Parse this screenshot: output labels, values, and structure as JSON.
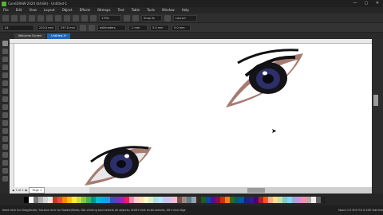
{
  "window": {
    "title": "CorelDRAW 2020 (64-Bit) - Untitled-1",
    "min": "—",
    "max": "▢",
    "close": "✕"
  },
  "menu": [
    "File",
    "Edit",
    "View",
    "Layout",
    "Object",
    "Effects",
    "Bitmaps",
    "Text",
    "Table",
    "Tools",
    "Window",
    "Help"
  ],
  "toolbar": {
    "zoom": "175%",
    "snap": "Snap To",
    "launch": "Launch"
  },
  "property_bar": {
    "page": "A4",
    "width": "210.0 mm",
    "height": "297.0 mm",
    "units": "millimeters",
    "nudge": ".1 mm",
    "dupe_x": "5.0 mm",
    "dupe_y": "5.0 mm"
  },
  "tabs": [
    {
      "label": "Welcome Screen"
    },
    {
      "label": "Untitled-1*"
    }
  ],
  "page_nav": {
    "label": "Page 1",
    "counter": "1 of 1"
  },
  "status": {
    "left": "Next click for Drag/Scale; Second click for Rotate/Skew; Dbl-clicking tool selects all objects; Shift+click multi-selects; Alt+click digs",
    "right": "None     C:0 M:0 Y:0 K:100  Hairline"
  },
  "palette_colors": [
    "#000000",
    "#ffffff",
    "#7a7a7a",
    "#b0b0b0",
    "#d4d4d4",
    "#e8e8e8",
    "#c0392b",
    "#e74c3c",
    "#ff8a00",
    "#ffc107",
    "#ffeb3b",
    "#cddc39",
    "#8bc34a",
    "#4caf50",
    "#009688",
    "#00bcd4",
    "#03a9f4",
    "#2196f3",
    "#3f51b5",
    "#673ab7",
    "#9c27b0",
    "#e91e63",
    "#f48fb1",
    "#ffcdd2",
    "#ffe0b2",
    "#fff9c4",
    "#dcedc8",
    "#b2dfdb",
    "#b3e5fc",
    "#c5cae9",
    "#d1c4e9",
    "#f8bbd0",
    "#795548",
    "#a1887f",
    "#607d8b",
    "#90a4ae",
    "#3e2723",
    "#1b5e20",
    "#0d47a1",
    "#4a148c",
    "#880e4f",
    "#bf360c",
    "#f57f17",
    "#33691e",
    "#006064",
    "#01579b",
    "#1a237e",
    "#311b92",
    "#4a0072",
    "#b71c1c",
    "#ff5722",
    "#ffab91",
    "#ffe082",
    "#c5e1a5",
    "#80cbc4",
    "#81d4fa",
    "#9fa8da",
    "#ce93d8",
    "#f48fb1",
    "#bcaaa4",
    "#eeeeee",
    "#616161",
    "#212121"
  ]
}
